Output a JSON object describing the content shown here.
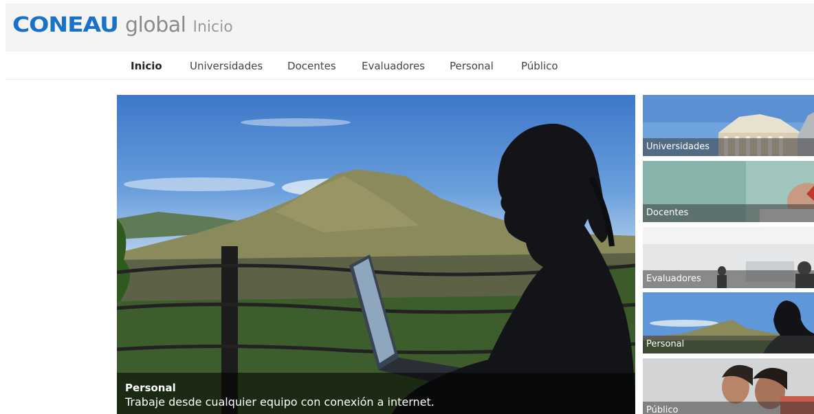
{
  "header": {
    "logo_mark": "CONEAU",
    "logo_global": "global",
    "section": "Inicio"
  },
  "nav": {
    "items": [
      {
        "label": "Inicio",
        "active": true
      },
      {
        "label": "Universidades"
      },
      {
        "label": "Docentes"
      },
      {
        "label": "Evaluadores"
      },
      {
        "label": "Personal"
      },
      {
        "label": "Público"
      }
    ]
  },
  "hero": {
    "title": "Personal",
    "text": "Trabaje desde cualquier equipo con conexión a internet."
  },
  "thumbnails": [
    {
      "label": "Universidades"
    },
    {
      "label": "Docentes"
    },
    {
      "label": "Evaluadores"
    },
    {
      "label": "Personal"
    },
    {
      "label": "Público"
    }
  ],
  "colors": {
    "brand_blue": "#1a72c8",
    "header_bg": "#f4f4f4"
  }
}
